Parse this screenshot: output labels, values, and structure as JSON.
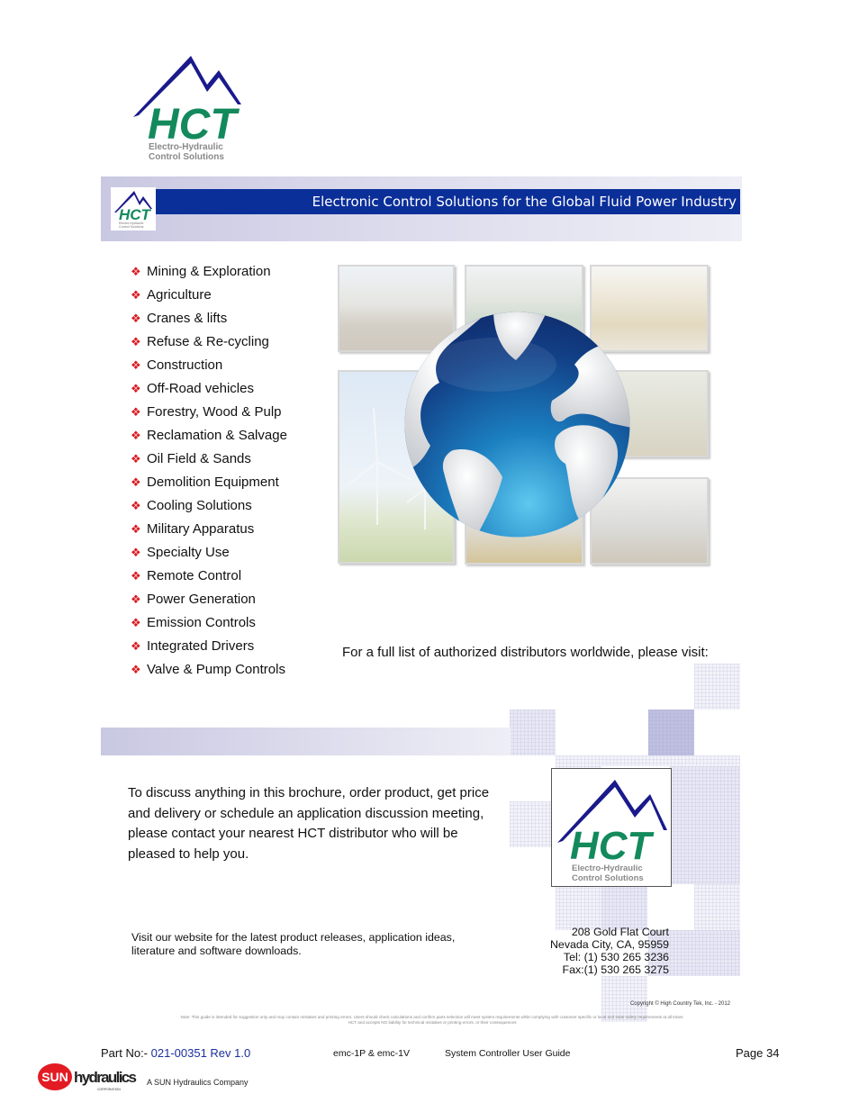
{
  "logo": {
    "brand": "HCT",
    "tagline_line1": "Electro-Hydraulic",
    "tagline_line2": "Control Solutions",
    "colors": {
      "mountain": "#1a1a8c",
      "letters": "#138a5c",
      "tagline": "#8a8a8a"
    }
  },
  "banner": {
    "title": "Electronic Control Solutions for the Global Fluid Power Industry",
    "bar_color": "#0b2f99"
  },
  "industries": {
    "bullet_icon": "❖",
    "bullet_color": "#d8181f",
    "items": [
      "Mining & Exploration",
      "Agriculture",
      "Cranes & lifts",
      "Refuse & Re-cycling",
      "Construction",
      "Off-Road vehicles",
      "Forestry, Wood & Pulp",
      "Reclamation & Salvage",
      "Oil Field & Sands",
      "Demolition Equipment",
      "Cooling Solutions",
      "Military Apparatus",
      "Specialty Use",
      "Remote Control",
      "Power Generation",
      "Emission Controls",
      "Integrated Drivers",
      "Valve & Pump Controls"
    ]
  },
  "collage": {
    "photos": [
      "mobile-crusher",
      "forage-harvester",
      "dump-truck",
      "wind-turbines",
      "forestry-mulcher",
      "trailer",
      "sprayer-vehicle"
    ],
    "center_icon": "globe-icon"
  },
  "distributors_text": "For a full list of authorized distributors worldwide, please visit:",
  "contact": {
    "paragraph": "To discuss anything in this brochure, order product, get price and delivery or schedule an application discussion meeting, please contact your nearest HCT distributor who will be pleased to help you.",
    "visit_text": "Visit our website for the latest product releases, application ideas, literature and software downloads.",
    "address": {
      "street": "208 Gold Flat Court",
      "city": "Nevada City, CA, 95959",
      "tel": "Tel: (1) 530 265 3236",
      "fax": "Fax:(1) 530 265 3275"
    }
  },
  "copyright": "Copyright © High Country Tek, Inc. - 2012",
  "disclaimer": {
    "line1": "Note: This guide is intended for suggestion only and may contain mistakes and printing errors. Users should check calculations and confirm parts selection will meet system requirements while complying with customer specific or local and state safety requirements at all times.",
    "line2": "HCT and accepts NO liability for technical mistakes or printing errors, or their consequences"
  },
  "footer": {
    "part_label": "Part No:- ",
    "part_number": "021-00351 Rev 1.0",
    "model": "emc-1P & emc-1V",
    "guide_title": "System Controller User Guide",
    "page": "Page 34",
    "sun_logo_text": "SUN",
    "sun_wordmark": "hydraulics",
    "sun_corp": "CORPORATION",
    "sun_tagline": "A SUN Hydraulics Company"
  }
}
